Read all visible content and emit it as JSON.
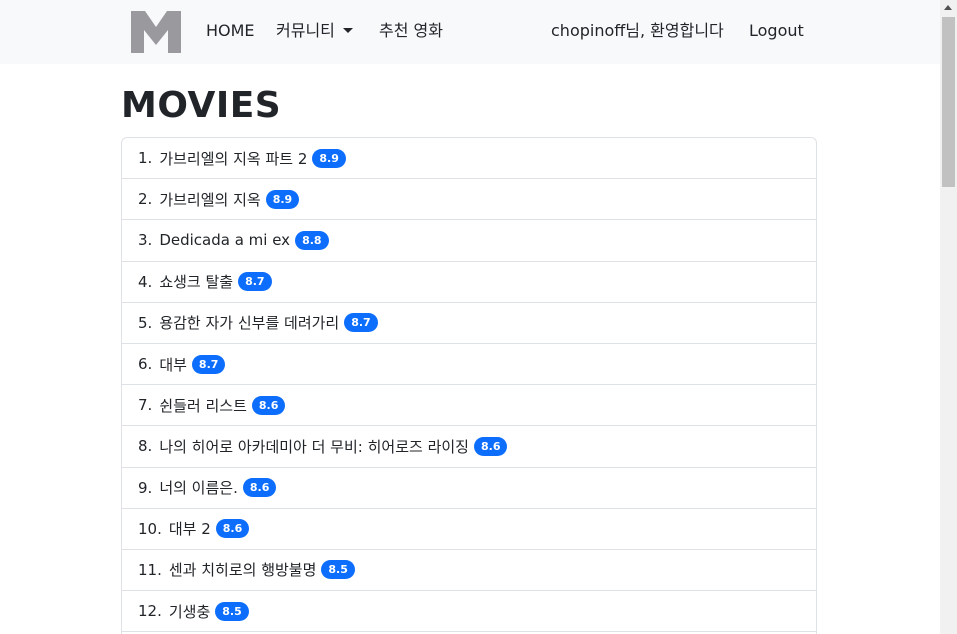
{
  "nav": {
    "home": "HOME",
    "community": "커뮤니티",
    "recommend": "추천 영화",
    "welcome": "chopinoff님, 환영합니다",
    "logout": "Logout"
  },
  "page_title": "MOVIES",
  "movies": [
    {
      "rank": "1.",
      "title": "가브리엘의 지옥 파트 2",
      "rating": "8.9"
    },
    {
      "rank": "2.",
      "title": "가브리엘의 지옥",
      "rating": "8.9"
    },
    {
      "rank": "3.",
      "title": "Dedicada a mi ex",
      "rating": "8.8"
    },
    {
      "rank": "4.",
      "title": "쇼생크 탈출",
      "rating": "8.7"
    },
    {
      "rank": "5.",
      "title": "용감한 자가 신부를 데려가리",
      "rating": "8.7"
    },
    {
      "rank": "6.",
      "title": "대부",
      "rating": "8.7"
    },
    {
      "rank": "7.",
      "title": "쉰들러 리스트",
      "rating": "8.6"
    },
    {
      "rank": "8.",
      "title": "나의 히어로 아카데미아 더 무비: 히어로즈 라이징",
      "rating": "8.6"
    },
    {
      "rank": "9.",
      "title": "너의 이름은.",
      "rating": "8.6"
    },
    {
      "rank": "10.",
      "title": "대부 2",
      "rating": "8.6"
    },
    {
      "rank": "11.",
      "title": "센과 치히로의 행방불명",
      "rating": "8.5"
    },
    {
      "rank": "12.",
      "title": "기생충",
      "rating": "8.5"
    }
  ],
  "colors": {
    "badge": "#0d6efd",
    "navbar_bg": "#f8f9fa",
    "logo": "#9a9a9e"
  }
}
